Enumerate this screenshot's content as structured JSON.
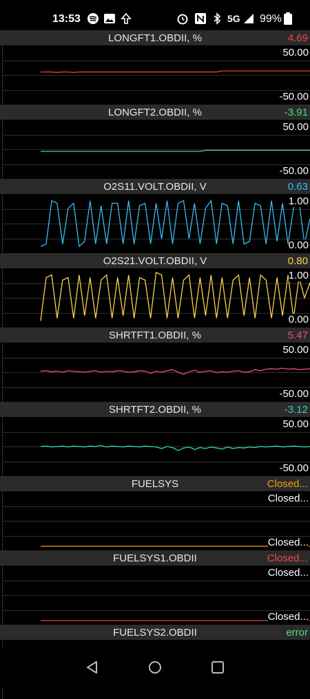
{
  "status_bar": {
    "time": "13:53",
    "battery": "99%",
    "network": "5G",
    "icons": [
      "spotify-icon",
      "gallery-icon",
      "tree-icon",
      "alarm-icon",
      "nfc-icon",
      "bluetooth-icon",
      "signal-icon",
      "battery-icon"
    ]
  },
  "panels": [
    {
      "id": "longft1",
      "title": "LONGFT1.OBDII, %",
      "value": "4.69",
      "color": "#ef4444",
      "ymax": "50.00",
      "ymin": "-50.00",
      "show_ymin": true,
      "series": [
        0.56,
        0.56,
        0.56,
        0.55,
        0.56,
        0.56,
        0.55,
        0.56,
        0.56,
        0.56,
        0.56,
        0.56,
        0.56,
        0.56,
        0.56,
        0.56,
        0.56,
        0.56,
        0.56,
        0.56,
        0.56,
        0.56,
        0.56,
        0.56,
        0.56,
        0.56,
        0.56,
        0.56,
        0.56,
        0.56,
        0.56,
        0.56,
        0.56,
        0.58,
        0.58,
        0.58,
        0.58,
        0.58,
        0.58,
        0.58,
        0.58,
        0.58,
        0.58,
        0.58,
        0.58,
        0.58,
        0.58,
        0.58,
        0.58,
        0.58
      ]
    },
    {
      "id": "longft2",
      "title": "LONGFT2.OBDII, %",
      "value": "-3.91",
      "color": "#4ade80",
      "ymax": "50.00",
      "ymin": "-50.00",
      "show_ymin": true,
      "series": [
        0.46,
        0.46,
        0.46,
        0.46,
        0.46,
        0.46,
        0.46,
        0.46,
        0.46,
        0.46,
        0.46,
        0.46,
        0.46,
        0.46,
        0.46,
        0.46,
        0.46,
        0.46,
        0.46,
        0.46,
        0.46,
        0.46,
        0.46,
        0.46,
        0.46,
        0.46,
        0.46,
        0.46,
        0.46,
        0.46,
        0.48,
        0.48,
        0.48,
        0.48,
        0.48,
        0.48,
        0.48,
        0.48,
        0.48,
        0.48,
        0.48,
        0.48,
        0.48,
        0.48,
        0.48,
        0.48,
        0.48,
        0.48,
        0.48,
        0.48
      ]
    },
    {
      "id": "o2s11",
      "title": "O2S11.VOLT.OBDII, V",
      "value": "0.63",
      "color": "#38bdf8",
      "ymax": "1.00",
      "ymin": "0.00",
      "show_ymin": true,
      "series": [
        0.05,
        0.1,
        0.95,
        0.9,
        0.1,
        0.8,
        0.9,
        0.05,
        0.15,
        0.95,
        0.1,
        0.85,
        0.1,
        0.9,
        0.9,
        0.1,
        0.95,
        0.1,
        0.85,
        0.9,
        0.1,
        0.9,
        0.2,
        0.95,
        0.1,
        0.9,
        0.95,
        0.2,
        0.9,
        0.1,
        0.8,
        0.95,
        0.1,
        0.9,
        0.85,
        0.1,
        0.95,
        0.1,
        0.15,
        0.9,
        0.85,
        0.1,
        0.95,
        0.15,
        0.9,
        0.1,
        0.8,
        0.95,
        0.1,
        0.6
      ]
    },
    {
      "id": "o2s21",
      "title": "O2S21.VOLT.OBDII, V",
      "value": "0.80",
      "color": "#fcd34d",
      "ymax": "1.00",
      "ymin": "0.00",
      "show_ymin": true,
      "series": [
        0.05,
        0.9,
        0.95,
        0.1,
        0.85,
        0.9,
        0.1,
        0.95,
        0.15,
        0.9,
        0.1,
        0.85,
        0.95,
        0.1,
        0.9,
        0.15,
        0.95,
        0.1,
        0.9,
        0.85,
        0.1,
        1.0,
        0.95,
        0.1,
        0.9,
        0.1,
        0.85,
        0.95,
        0.1,
        0.9,
        0.15,
        0.95,
        0.1,
        0.9,
        0.1,
        0.85,
        0.95,
        0.15,
        0.9,
        0.1,
        0.95,
        0.85,
        0.1,
        0.9,
        0.15,
        0.95,
        0.1,
        0.9,
        0.5,
        0.8
      ]
    },
    {
      "id": "shrtft1",
      "title": "SHRTFT1.OBDII, %",
      "value": "5.47",
      "color": "#ec4899",
      "ymax": "50.00",
      "ymin": "-50.00",
      "show_ymin": true,
      "series": [
        0.52,
        0.53,
        0.51,
        0.52,
        0.5,
        0.53,
        0.52,
        0.51,
        0.5,
        0.52,
        0.53,
        0.5,
        0.52,
        0.51,
        0.53,
        0.52,
        0.5,
        0.51,
        0.53,
        0.52,
        0.48,
        0.52,
        0.5,
        0.53,
        0.55,
        0.5,
        0.46,
        0.51,
        0.54,
        0.5,
        0.52,
        0.53,
        0.49,
        0.51,
        0.5,
        0.52,
        0.53,
        0.5,
        0.51,
        0.55,
        0.53,
        0.56,
        0.57,
        0.56,
        0.58,
        0.56,
        0.57,
        0.55,
        0.56,
        0.57
      ]
    },
    {
      "id": "shrtft2",
      "title": "SHRTFT2.OBDII, %",
      "value": "-3.12",
      "color": "#2dd4bf",
      "ymax": "50.00",
      "ymin": "-50.00",
      "show_ymin": true,
      "series": [
        0.5,
        0.51,
        0.49,
        0.5,
        0.51,
        0.49,
        0.51,
        0.5,
        0.49,
        0.51,
        0.5,
        0.52,
        0.49,
        0.51,
        0.5,
        0.49,
        0.51,
        0.5,
        0.49,
        0.51,
        0.5,
        0.49,
        0.46,
        0.5,
        0.48,
        0.42,
        0.47,
        0.49,
        0.44,
        0.48,
        0.46,
        0.49,
        0.47,
        0.45,
        0.49,
        0.46,
        0.48,
        0.47,
        0.49,
        0.48,
        0.5,
        0.49,
        0.5,
        0.51,
        0.49,
        0.5,
        0.51,
        0.5,
        0.49,
        0.5
      ]
    },
    {
      "id": "fuelsys",
      "title": "FUELSYS",
      "value": "Closed...",
      "color": "#f59e0b",
      "ymax": "Closed...",
      "ymin": "Closed...",
      "show_ymin": true,
      "series": [
        0.0,
        0.0,
        0.0,
        0.0,
        0.0,
        0.0,
        0.0,
        0.0,
        0.0,
        0.0,
        0.0,
        0.0,
        0.0,
        0.0,
        0.0,
        0.0,
        0.0,
        0.0,
        0.0,
        0.0,
        0.0,
        0.0,
        0.0,
        0.0,
        0.0,
        0.0,
        0.0,
        0.0,
        0.0,
        0.0,
        0.0,
        0.0,
        0.0,
        0.0,
        0.0,
        0.0,
        0.0,
        0.0,
        0.0,
        0.0,
        0.0,
        0.0,
        0.0,
        0.0,
        0.0,
        0.0,
        0.0,
        0.0,
        0.0,
        0.0
      ]
    },
    {
      "id": "fuelsys1",
      "title": "FUELSYS1.OBDII",
      "value": "Closed...",
      "color": "#ef4444",
      "ymax": "Closed...",
      "ymin": "Closed...",
      "show_ymin": true,
      "series": [
        0.0,
        0.0,
        0.0,
        0.0,
        0.0,
        0.0,
        0.0,
        0.0,
        0.0,
        0.0,
        0.0,
        0.0,
        0.0,
        0.0,
        0.0,
        0.0,
        0.0,
        0.0,
        0.0,
        0.0,
        0.0,
        0.0,
        0.0,
        0.0,
        0.0,
        0.0,
        0.0,
        0.0,
        0.0,
        0.0,
        0.0,
        0.0,
        0.0,
        0.0,
        0.0,
        0.0,
        0.0,
        0.0,
        0.0,
        0.0,
        0.0,
        0.0,
        0.0,
        0.0,
        0.0,
        0.0,
        0.0,
        0.0,
        0.0,
        0.0
      ]
    },
    {
      "id": "fuelsys2",
      "title": "FUELSYS2.OBDII",
      "value": "error",
      "color": "#4ade80",
      "ymax": "",
      "ymin": "",
      "show_ymin": false,
      "series": []
    }
  ],
  "nav": {
    "icons": [
      "back-icon",
      "home-icon",
      "recents-icon"
    ]
  }
}
